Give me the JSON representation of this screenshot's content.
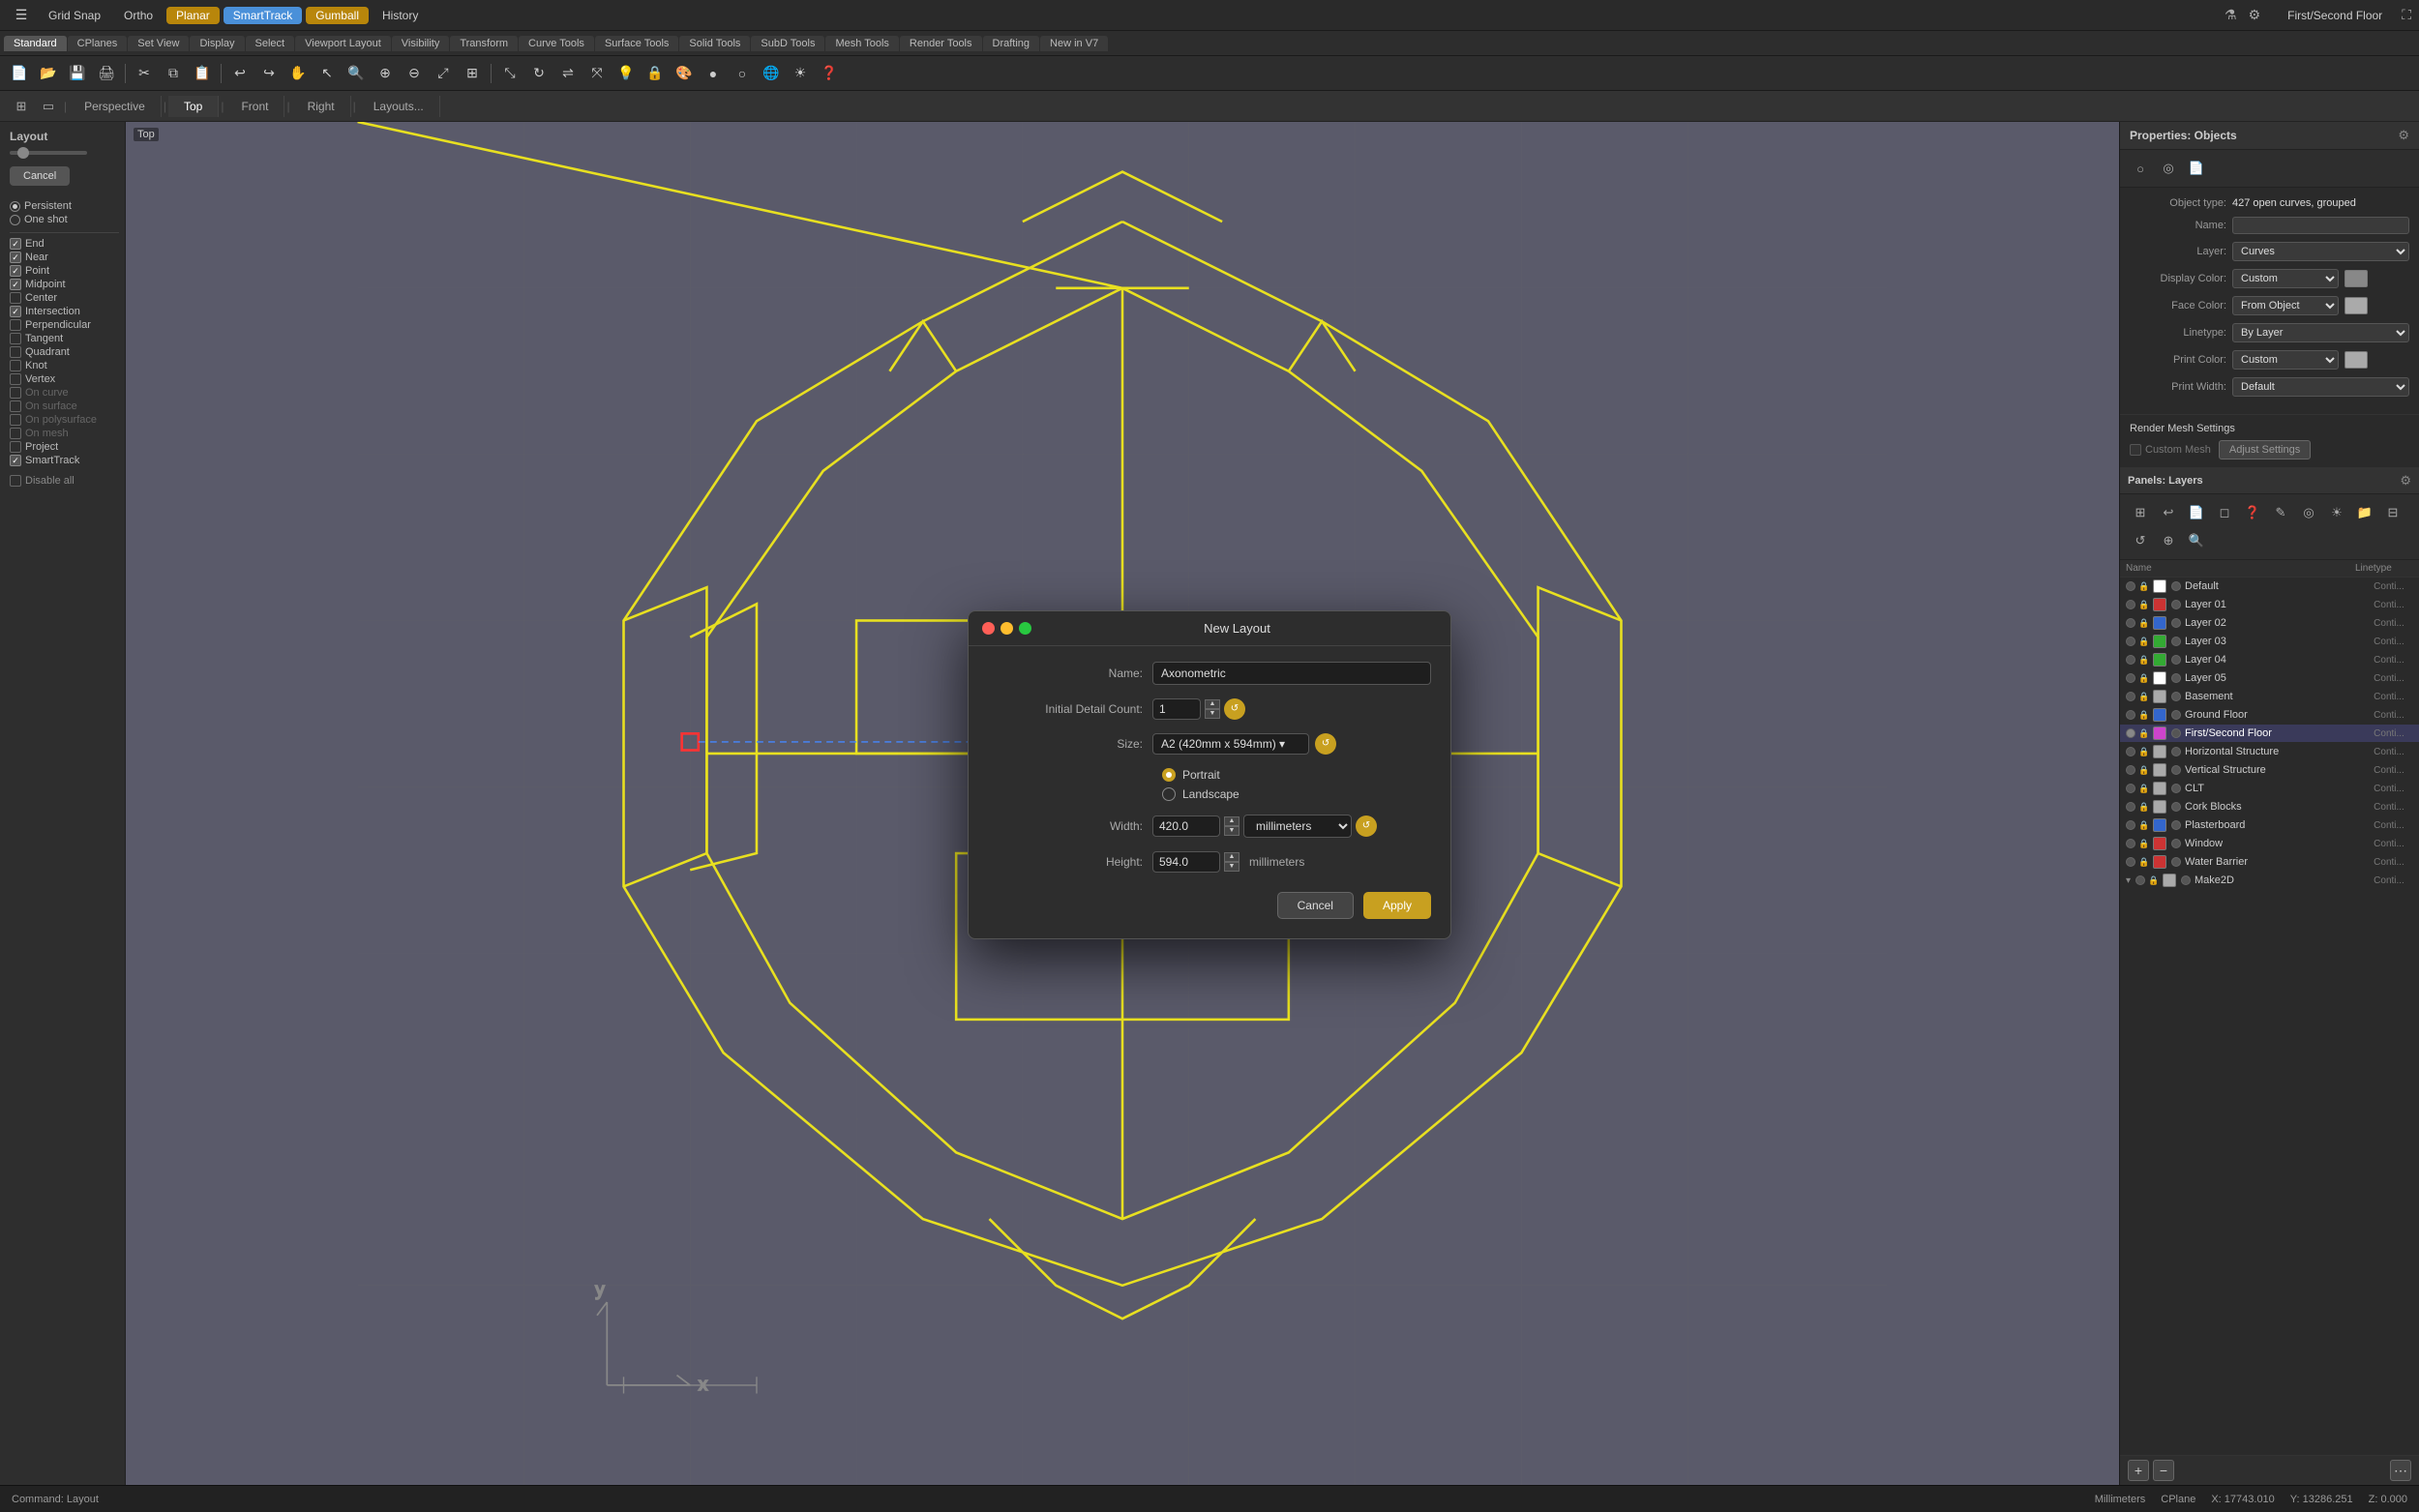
{
  "app": {
    "window_title": "First/Second Floor"
  },
  "top_menu": {
    "grid_snap": "Grid Snap",
    "ortho": "Ortho",
    "planar": "Planar",
    "smart_track": "SmartTrack",
    "gumball": "Gumball",
    "history": "History"
  },
  "toolbar_tabs": [
    "Standard",
    "CPlanes",
    "Set View",
    "Display",
    "Select",
    "Viewport Layout",
    "Visibility",
    "Transform",
    "Curve Tools",
    "Surface Tools",
    "Solid Tools",
    "SubD Tools",
    "Mesh Tools",
    "Render Tools",
    "Drafting",
    "New in V7"
  ],
  "viewport_tabs": [
    "Perspective",
    "Top",
    "Front",
    "Right",
    "Layouts..."
  ],
  "active_viewport": "Top",
  "viewport_label": "Top",
  "left_sidebar": {
    "title": "Layout",
    "cancel_btn": "Cancel",
    "snap_sections": [
      {
        "label": "Persistent",
        "type": "radio",
        "checked": true
      },
      {
        "label": "One shot",
        "type": "radio",
        "checked": false
      }
    ],
    "snap_items": [
      {
        "label": "End",
        "checked": true
      },
      {
        "label": "Near",
        "checked": true
      },
      {
        "label": "Point",
        "checked": true
      },
      {
        "label": "Midpoint",
        "checked": true
      },
      {
        "label": "Center",
        "checked": false
      },
      {
        "label": "Intersection",
        "checked": true
      },
      {
        "label": "Perpendicular",
        "checked": false
      },
      {
        "label": "Tangent",
        "checked": false
      },
      {
        "label": "Quadrant",
        "checked": false
      },
      {
        "label": "Knot",
        "checked": false
      },
      {
        "label": "Vertex",
        "checked": false
      },
      {
        "label": "On curve",
        "checked": false,
        "disabled": true
      },
      {
        "label": "On surface",
        "checked": false,
        "disabled": true
      },
      {
        "label": "On polysurface",
        "checked": false,
        "disabled": true
      },
      {
        "label": "On mesh",
        "checked": false,
        "disabled": true
      },
      {
        "label": "Project",
        "checked": false
      },
      {
        "label": "SmartTrack",
        "checked": true
      }
    ],
    "disable_all": "Disable all"
  },
  "modal": {
    "title": "New Layout",
    "name_label": "Name:",
    "name_value": "Axonometric",
    "detail_count_label": "Initial Detail Count:",
    "detail_count_value": "1",
    "size_label": "Size:",
    "size_value": "A2 (420mm x 594mm)",
    "portrait_label": "Portrait",
    "landscape_label": "Landscape",
    "portrait_selected": true,
    "width_label": "Width:",
    "width_value": "420.0",
    "height_label": "Height:",
    "height_value": "594.0",
    "unit_value": "millimeters",
    "cancel_btn": "Cancel",
    "apply_btn": "Apply"
  },
  "right_panel": {
    "properties_title": "Properties: Objects",
    "object_type_label": "Object type:",
    "object_type_value": "427 open curves, grouped",
    "name_label": "Name:",
    "name_value": "",
    "layer_label": "Layer:",
    "layer_value": "Curves",
    "display_color_label": "Display Color:",
    "display_color_value": "Custom",
    "face_color_label": "Face Color:",
    "face_color_value": "From Object",
    "linetype_label": "Linetype:",
    "linetype_value": "By Layer",
    "print_color_label": "Print Color:",
    "print_color_value": "Custom",
    "print_width_label": "Print Width:",
    "print_width_value": "Default",
    "render_mesh_title": "Render Mesh Settings",
    "custom_mesh_label": "Custom Mesh",
    "adjust_settings_label": "Adjust Settings",
    "layers_title": "Panels: Layers",
    "layers_col_name": "Name",
    "layers_col_linetype": "Linetype",
    "layers": [
      {
        "name": "Default",
        "color": "#ffffff",
        "active": false,
        "linetype": "Conti..."
      },
      {
        "name": "Layer 01",
        "color": "#ff4444",
        "active": false,
        "linetype": "Conti..."
      },
      {
        "name": "Layer 02",
        "color": "#4488ff",
        "active": false,
        "linetype": "Conti..."
      },
      {
        "name": "Layer 03",
        "color": "#44cc44",
        "active": false,
        "linetype": "Conti..."
      },
      {
        "name": "Layer 04",
        "color": "#44cc44",
        "active": false,
        "linetype": "Conti..."
      },
      {
        "name": "Layer 05",
        "color": "#ffffff",
        "active": false,
        "linetype": "Conti..."
      },
      {
        "name": "Basement",
        "color": "#ffffff",
        "active": false,
        "linetype": "Conti..."
      },
      {
        "name": "Ground Floor",
        "color": "#4488ff",
        "active": false,
        "linetype": "Conti..."
      },
      {
        "name": "First/Second Floor",
        "color": "#cc44cc",
        "active": true,
        "linetype": "Conti..."
      },
      {
        "name": "Horizontal Structure",
        "color": "#ffffff",
        "active": false,
        "linetype": "Conti..."
      },
      {
        "name": "Vertical Structure",
        "color": "#ffffff",
        "active": false,
        "linetype": "Conti..."
      },
      {
        "name": "CLT",
        "color": "#ffffff",
        "active": false,
        "linetype": "Conti..."
      },
      {
        "name": "Cork Blocks",
        "color": "#ffffff",
        "active": false,
        "linetype": "Conti..."
      },
      {
        "name": "Plasterboard",
        "color": "#4488ff",
        "active": false,
        "linetype": "Conti..."
      },
      {
        "name": "Window",
        "color": "#ff4444",
        "active": false,
        "linetype": "Conti..."
      },
      {
        "name": "Water Barrier",
        "color": "#ff4444",
        "active": false,
        "linetype": "Conti..."
      },
      {
        "name": "Make2D",
        "color": "#ffffff",
        "active": false,
        "linetype": "Conti...",
        "expanded": true
      }
    ]
  },
  "status_bar": {
    "command": "Command: Layout",
    "unit": "Millimeters",
    "cplane": "CPlane",
    "x": "X: 17743.010",
    "y": "Y: 13286.251",
    "z": "Z: 0.000"
  }
}
